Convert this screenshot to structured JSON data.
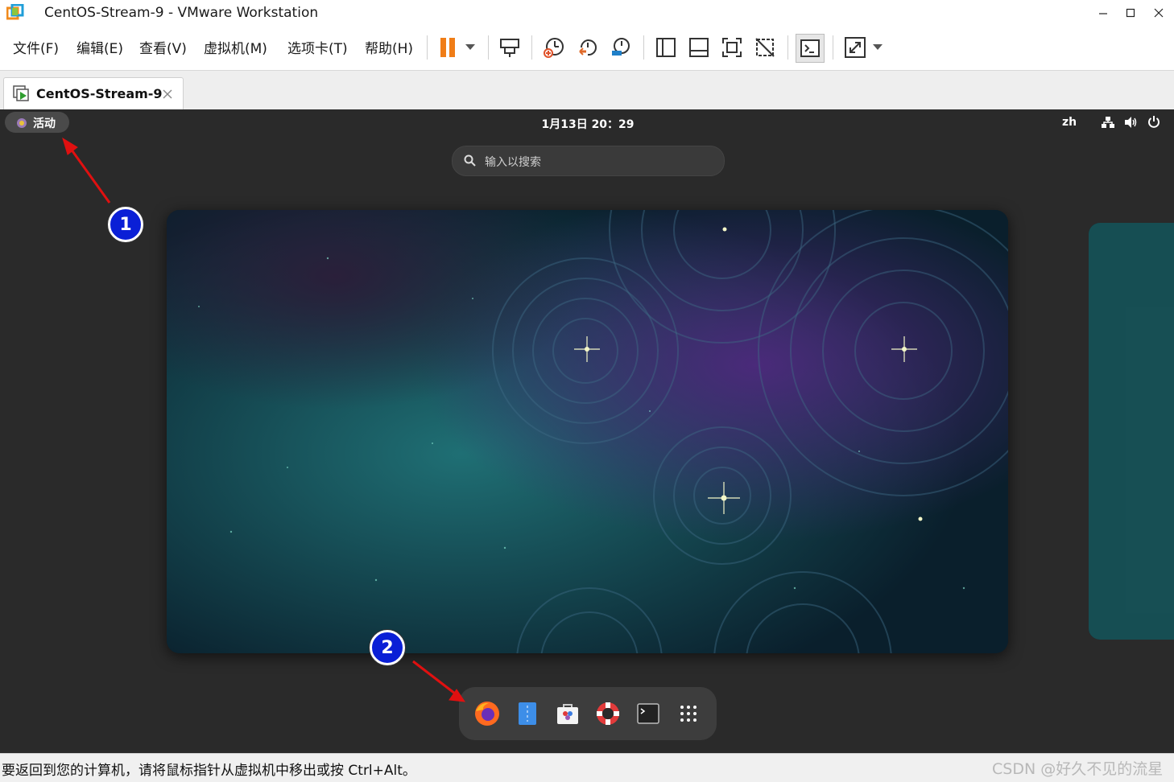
{
  "window": {
    "title": "CentOS-Stream-9 - VMware Workstation"
  },
  "menu": {
    "items": [
      "文件(F)",
      "编辑(E)",
      "查看(V)",
      "虚拟机(M)",
      "选项卡(T)",
      "帮助(H)"
    ]
  },
  "toolbar": {
    "icons": [
      "pause-icon",
      "send-ctrl-alt-del-icon",
      "snapshot-icon",
      "revert-snapshot-icon",
      "snapshot-manager-icon",
      "library-view-icon",
      "console-view-icon",
      "full-screen-icon",
      "unity-icon",
      "terminal-console-icon",
      "stretch-icon"
    ]
  },
  "tab": {
    "label": "CentOS-Stream-9"
  },
  "guest": {
    "activities": "活动",
    "clock": "1月13日  20：29",
    "language": "zh",
    "search_placeholder": "输入以搜索",
    "dock_apps": [
      "firefox-icon",
      "text-editor-icon",
      "software-icon",
      "help-icon",
      "terminal-icon",
      "show-apps-icon"
    ]
  },
  "annotations": {
    "marker_1": "1",
    "marker_2": "2"
  },
  "statusbar": {
    "text": "要返回到您的计算机，请将鼠标指针从虚拟机中移出或按 Ctrl+Alt。",
    "watermark": "CSDN @好久不见的流星"
  },
  "colors": {
    "accent_orange": "#f07d17",
    "annotation_blue": "#0a1fd6",
    "annotation_arrow": "#e01010"
  }
}
